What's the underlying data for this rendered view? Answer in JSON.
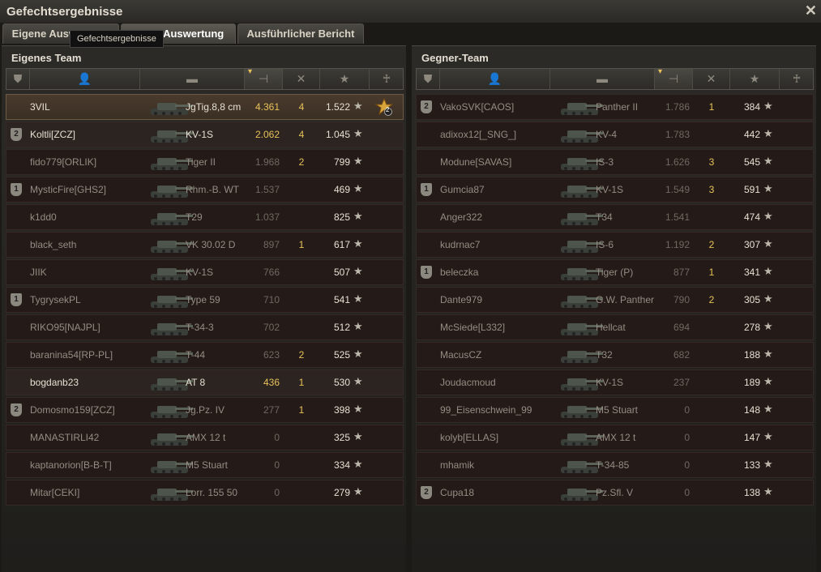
{
  "window": {
    "title": "Gefechtsergebnisse"
  },
  "tabs": [
    {
      "label": "Eigene Auswertung"
    },
    {
      "label": "Team-Auswertung"
    },
    {
      "label": "Ausführlicher Bericht"
    }
  ],
  "tooltip": "Gefechtsergebnisse",
  "own_team": {
    "title": "Eigenes Team",
    "rows": [
      {
        "name": "3VIL",
        "tank": "JgTig.8,8 cm",
        "damage": "4.361",
        "kills": "4",
        "xp": "1.522",
        "medal": "2"
      },
      {
        "name": "Koltli[ZCZ]",
        "tank": "KV-1S",
        "damage": "2.062",
        "kills": "4",
        "xp": "1.045"
      },
      {
        "name": "fido779[ORLIK]",
        "tank": "Tiger II",
        "damage": "1.968",
        "kills": "2",
        "xp": "799"
      },
      {
        "name": "MysticFire[GHS2]",
        "tank": "Rhm.-B. WT",
        "damage": "1.537",
        "kills": "",
        "xp": "469"
      },
      {
        "name": "k1dd0",
        "tank": "T29",
        "damage": "1.037",
        "kills": "",
        "xp": "825"
      },
      {
        "name": "black_seth",
        "tank": "VK 30.02 D",
        "damage": "897",
        "kills": "1",
        "xp": "617"
      },
      {
        "name": "JIIK",
        "tank": "KV-1S",
        "damage": "766",
        "kills": "",
        "xp": "507"
      },
      {
        "name": "TygrysekPL",
        "tank": "Type 59",
        "damage": "710",
        "kills": "",
        "xp": "541"
      },
      {
        "name": "RIKO95[NAJPL]",
        "tank": "T-34-3",
        "damage": "702",
        "kills": "",
        "xp": "512"
      },
      {
        "name": "baranina54[RP-PL]",
        "tank": "T-44",
        "damage": "623",
        "kills": "2",
        "xp": "525"
      },
      {
        "name": "bogdanb23",
        "tank": "AT 8",
        "damage": "436",
        "kills": "1",
        "xp": "530"
      },
      {
        "name": "Domosmo159[ZCZ]",
        "tank": "Jg.Pz. IV",
        "damage": "277",
        "kills": "1",
        "xp": "398"
      },
      {
        "name": "MANASTIRLI42",
        "tank": "AMX 12 t",
        "damage": "0",
        "kills": "",
        "xp": "325"
      },
      {
        "name": "kaptanorion[B-B-T]",
        "tank": "M5 Stuart",
        "damage": "0",
        "kills": "",
        "xp": "334"
      },
      {
        "name": "Mitar[CEKI]",
        "tank": "Lorr. 155 50",
        "damage": "0",
        "kills": "",
        "xp": "279"
      }
    ]
  },
  "enemy_team": {
    "title": "Gegner-Team",
    "rows": [
      {
        "name": "VakoSVK[CAOS]",
        "tank": "Panther II",
        "damage": "1.786",
        "kills": "1",
        "xp": "384"
      },
      {
        "name": "adixox12[_SNG_]",
        "tank": "KV-4",
        "damage": "1.783",
        "kills": "",
        "xp": "442"
      },
      {
        "name": "Modune[SAVAS]",
        "tank": "IS-3",
        "damage": "1.626",
        "kills": "3",
        "xp": "545"
      },
      {
        "name": "Gumcia87",
        "tank": "KV-1S",
        "damage": "1.549",
        "kills": "3",
        "xp": "591"
      },
      {
        "name": "Anger322",
        "tank": "T34",
        "damage": "1.541",
        "kills": "",
        "xp": "474"
      },
      {
        "name": "kudrnac7",
        "tank": "IS-6",
        "damage": "1.192",
        "kills": "2",
        "xp": "307"
      },
      {
        "name": "beleczka",
        "tank": "Tiger (P)",
        "damage": "877",
        "kills": "1",
        "xp": "341"
      },
      {
        "name": "Dante979",
        "tank": "G.W. Panther",
        "damage": "790",
        "kills": "2",
        "xp": "305"
      },
      {
        "name": "McSiede[L332]",
        "tank": "Hellcat",
        "damage": "694",
        "kills": "",
        "xp": "278"
      },
      {
        "name": "MacusCZ",
        "tank": "T32",
        "damage": "682",
        "kills": "",
        "xp": "188"
      },
      {
        "name": "Joudacmoud",
        "tank": "KV-1S",
        "damage": "237",
        "kills": "",
        "xp": "189"
      },
      {
        "name": "99_Eisenschwein_99",
        "tank": "M5 Stuart",
        "damage": "0",
        "kills": "",
        "xp": "148"
      },
      {
        "name": "kolyb[ELLAS]",
        "tank": "AMX 12 t",
        "damage": "0",
        "kills": "",
        "xp": "147"
      },
      {
        "name": "mhamik",
        "tank": "T-34-85",
        "damage": "0",
        "kills": "",
        "xp": "133"
      },
      {
        "name": "Cupa18",
        "tank": "Pz.Sfl. V",
        "damage": "0",
        "kills": "",
        "xp": "138"
      }
    ]
  },
  "platoon_badges": {
    "own": [
      "",
      "2",
      "",
      "1",
      "",
      "",
      "",
      "1",
      "",
      "",
      "",
      "2",
      "",
      "",
      ""
    ],
    "enemy": [
      "2",
      "",
      "",
      "1",
      "",
      "",
      "1",
      "",
      "",
      "",
      "",
      "",
      "",
      "",
      "2"
    ]
  },
  "icons": {
    "squad": "squad-icon",
    "player": "player-icon",
    "tank": "tank-icon",
    "damage": "damage-icon",
    "kills": "kills-icon",
    "xp": "star-icon",
    "medal": "medal-icon"
  },
  "colors": {
    "accent": "#e8c25a",
    "background": "#1b1a17",
    "row": "#241b19"
  }
}
